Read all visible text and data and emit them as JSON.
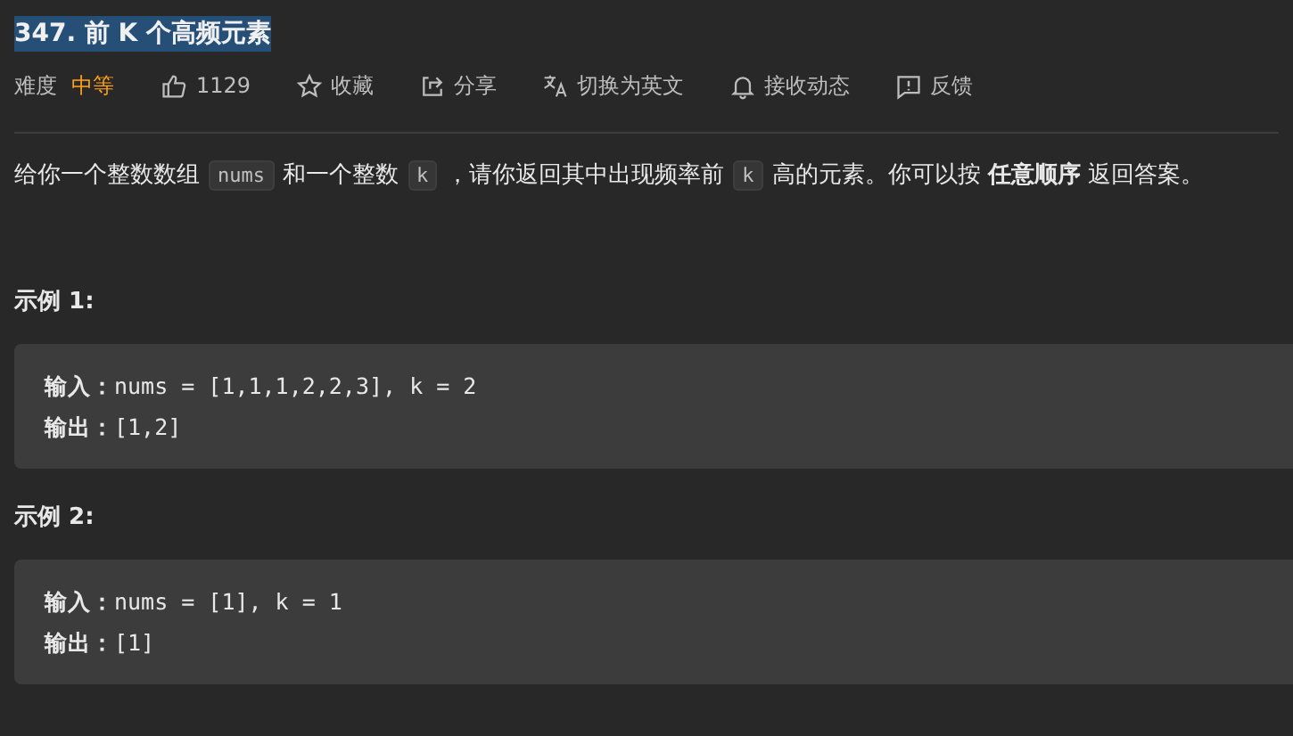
{
  "title": {
    "text": "347. 前 K 个高频元素",
    "selected": true
  },
  "toolbar": {
    "difficulty_label": "难度",
    "difficulty": "中等",
    "actions": [
      {
        "kind": "like",
        "label": "1129"
      },
      {
        "kind": "star",
        "label": "收藏"
      },
      {
        "kind": "share",
        "label": "分享"
      },
      {
        "kind": "translate",
        "label": "切换为英文"
      },
      {
        "kind": "bell",
        "label": "接收动态"
      },
      {
        "kind": "feedback",
        "label": "反馈"
      }
    ]
  },
  "description": [
    {
      "kind": "text",
      "text": "给你一个整数数组"
    },
    {
      "kind": "code",
      "text": "nums"
    },
    {
      "kind": "text",
      "text": "和一个整数"
    },
    {
      "kind": "code",
      "text": "k"
    },
    {
      "kind": "text",
      "text": "，请你返回其中出现频率前"
    },
    {
      "kind": "code",
      "text": "k"
    },
    {
      "kind": "text",
      "text": "高的元素。你可以按 **任意顺序** 返回答案。"
    }
  ],
  "examples": [
    {
      "heading": "示例 1:",
      "lines": [
        {
          "label": "输入：",
          "value": "nums = [1,1,1,2,2,3], k = 2"
        },
        {
          "label": "输出：",
          "value": "[1,2]"
        }
      ]
    },
    {
      "heading": "示例 2:",
      "lines": [
        {
          "label": "输入：",
          "value": "nums = [1], k = 1"
        },
        {
          "label": "输出：",
          "value": "[1]"
        }
      ]
    }
  ]
}
